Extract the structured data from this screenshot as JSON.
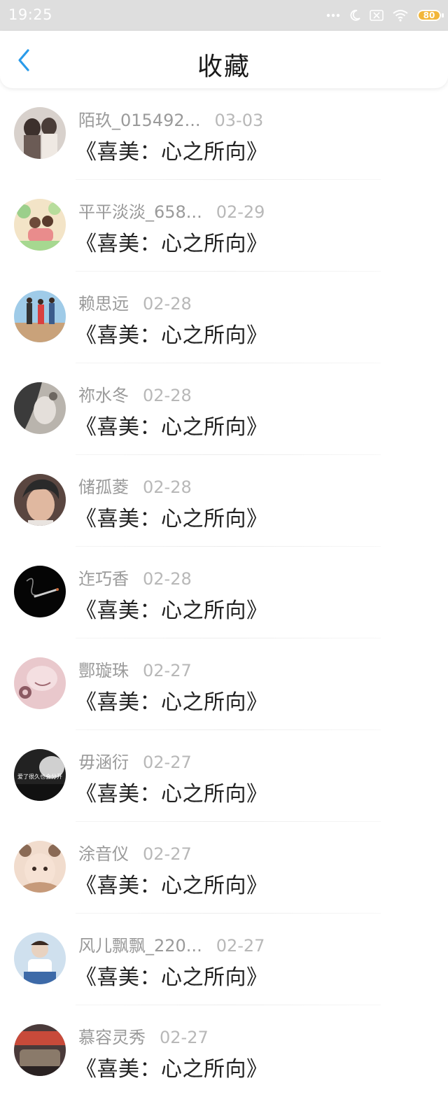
{
  "status_bar": {
    "time": "19:25",
    "battery": "80",
    "battery_color": "#f2b63a"
  },
  "header": {
    "title": "收藏",
    "back_icon": "chevron-left-icon",
    "accent": "#2a9bea"
  },
  "items": [
    {
      "name": "陌玖_015492...",
      "date": "03-03",
      "title": "《喜美：心之所向》",
      "avatar_colors": [
        "#6b5b55",
        "#d8d1cc"
      ]
    },
    {
      "name": "平平淡淡_658...",
      "date": "02-29",
      "title": "《喜美：心之所向》",
      "avatar_colors": [
        "#9ccf8b",
        "#f3e4c7"
      ]
    },
    {
      "name": "赖思远",
      "date": "02-28",
      "title": "《喜美：心之所向》",
      "avatar_colors": [
        "#9fcbe8",
        "#c9a27a"
      ]
    },
    {
      "name": "祢水冬",
      "date": "02-28",
      "title": "《喜美：心之所向》",
      "avatar_colors": [
        "#3b3b3b",
        "#b9b4ad"
      ]
    },
    {
      "name": "储孤菱",
      "date": "02-28",
      "title": "《喜美：心之所向》",
      "avatar_colors": [
        "#2a2a2a",
        "#e0b8a0"
      ]
    },
    {
      "name": "迮巧香",
      "date": "02-28",
      "title": "《喜美：心之所向》",
      "avatar_colors": [
        "#050505",
        "#8a8a8a"
      ]
    },
    {
      "name": "酆璇珠",
      "date": "02-27",
      "title": "《喜美：心之所向》",
      "avatar_colors": [
        "#e9c8cc",
        "#8c5a63"
      ]
    },
    {
      "name": "毋涵衍",
      "date": "02-27",
      "title": "《喜美：心之所向》",
      "avatar_colors": [
        "#222222",
        "#d0d0d0"
      ],
      "avatar_caption": "爱了很久也会分开"
    },
    {
      "name": "涂音仪",
      "date": "02-27",
      "title": "《喜美：心之所向》",
      "avatar_colors": [
        "#c69a7a",
        "#f1dccd"
      ]
    },
    {
      "name": "风儿飘飘_220...",
      "date": "02-27",
      "title": "《喜美：心之所向》",
      "avatar_colors": [
        "#3d6aa8",
        "#e8d2c0"
      ]
    },
    {
      "name": "慕容灵秀",
      "date": "02-27",
      "title": "《喜美：心之所向》",
      "avatar_colors": [
        "#4a3a3a",
        "#c84a3a"
      ]
    }
  ]
}
